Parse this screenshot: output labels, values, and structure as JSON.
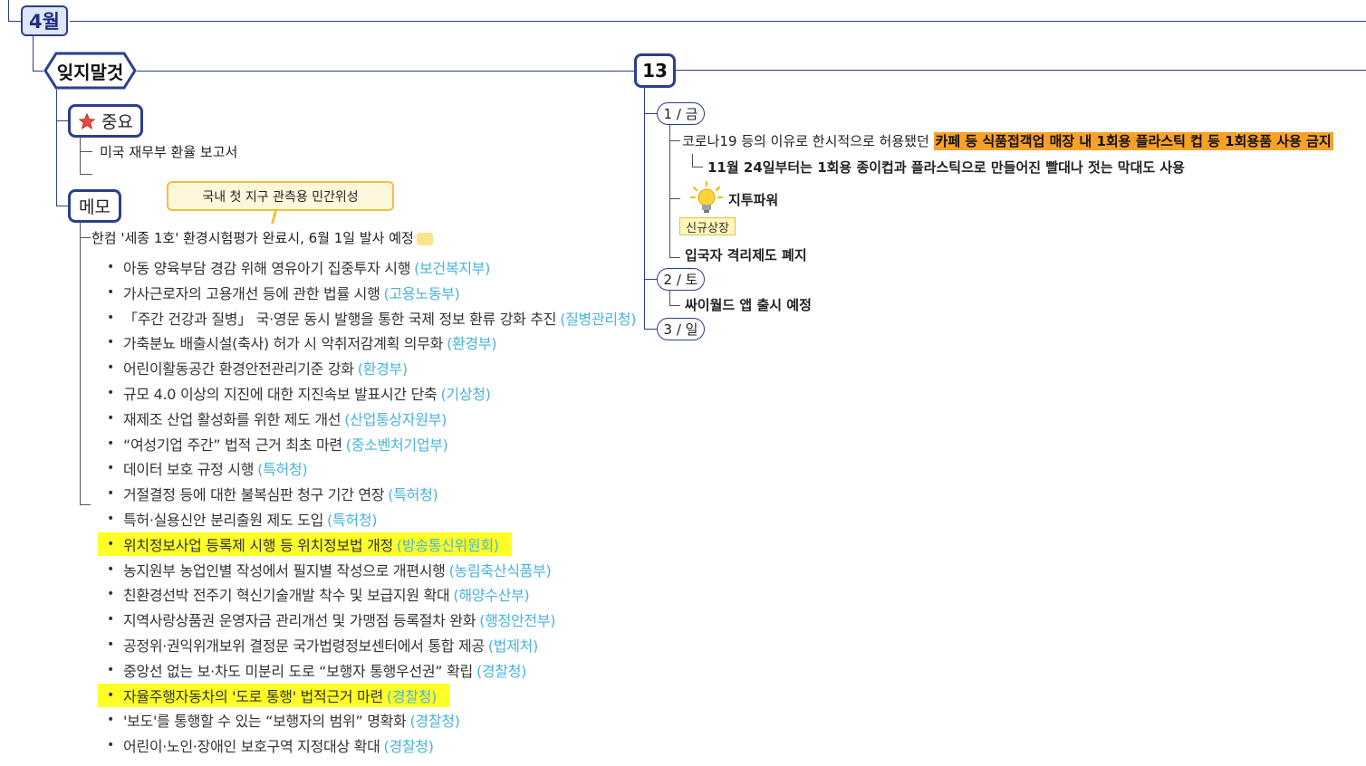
{
  "month": "4월",
  "hex_label": "잊지말것",
  "date_node": "13",
  "important": {
    "label": "중요",
    "items": [
      "미국 재무부 환율 보고서",
      ""
    ]
  },
  "memo": {
    "label": "메모",
    "callout": "국내 첫 지구 관측용 민간위성",
    "line": "한컴 '세종 1호'  환경시험평가  완료시, 6월 1일 발사 예정"
  },
  "policies": [
    {
      "text": "아동 양육부담 경감 위해 영유아기 집중투자 시행",
      "agency": "(보건복지부)",
      "highlight": false
    },
    {
      "text": "가사근로자의 고용개선 등에 관한 법률 시행",
      "agency": "(고용노동부)",
      "highlight": false
    },
    {
      "text": "「주간 건강과 질병」 국·영문 동시 발행을 통한 국제 정보 환류 강화 추진",
      "agency": "(질병관리청)",
      "highlight": false
    },
    {
      "text": "가축분뇨 배출시설(축사) 허가 시 악취저감계획 의무화",
      "agency": "(환경부)",
      "highlight": false
    },
    {
      "text": "어린이활동공간 환경안전관리기준 강화",
      "agency": "(환경부)",
      "highlight": false
    },
    {
      "text": "규모 4.0 이상의 지진에 대한 지진속보 발표시간 단축",
      "agency": "(기상청)",
      "highlight": false
    },
    {
      "text": "재제조 산업 활성화를 위한 제도 개선",
      "agency": "(산업통상자원부)",
      "highlight": false
    },
    {
      "text": "“여성기업 주간” 법적 근거 최초 마련",
      "agency": "(중소벤처기업부)",
      "highlight": false
    },
    {
      "text": "데이터 보호 규정 시행",
      "agency": "(특허청)",
      "highlight": false
    },
    {
      "text": "거절결정 등에 대한 불복심판 청구 기간 연장",
      "agency": "(특허청)",
      "highlight": false
    },
    {
      "text": "특허·실용신안 분리출원 제도 도입",
      "agency": "(특허청)",
      "highlight": false
    },
    {
      "text": "위치정보사업 등록제 시행 등 위치정보법 개정",
      "agency": "(방송통신위원회)",
      "highlight": true
    },
    {
      "text": "농지원부 농업인별 작성에서 필지별 작성으로 개편시행",
      "agency": "(농림축산식품부)",
      "highlight": false
    },
    {
      "text": "친환경선박 전주기 혁신기술개발 착수 및 보급지원 확대",
      "agency": "(해양수산부)",
      "highlight": false
    },
    {
      "text": "지역사랑상품권 운영자금 관리개선 및 가맹점 등록절차 완화",
      "agency": "(행정안전부)",
      "highlight": false
    },
    {
      "text": "공정위·권익위개보위 결정문 국가법령정보센터에서 통합 제공",
      "agency": "(법제처)",
      "highlight": false
    },
    {
      "text": "중앙선 없는 보·차도 미분리 도로 “보행자 통행우선권” 확립",
      "agency": "(경찰청)",
      "highlight": false
    },
    {
      "text": "자율주행자동차의 '도로 통행' 법적근거 마련",
      "agency": "(경찰청)",
      "highlight": true
    },
    {
      "text": "'보도'를 통행할 수 있는 “보행자의 범위” 명확화",
      "agency": "(경찰청)",
      "highlight": false
    },
    {
      "text": "어린이·노인·장애인 보호구역 지정대상 확대",
      "agency": "(경찰청)",
      "highlight": false
    }
  ],
  "schedule": {
    "day1": {
      "label": "1 / 금",
      "text_plain": "코로나19 등의 이유로 한시적으로 허용됐던 ",
      "text_highlight": "카페 등 식품접객업 매장 내 1회용 플라스틱 컵 등 1회용품 사용 금지",
      "sub": "11월 24일부터는 1회용 종이컵과 플라스틱으로 만들어진 빨대나 젓는 막대도 사용",
      "item2": "지투파워",
      "badge": "신규상장",
      "item3": "입국자 격리제도 폐지"
    },
    "day2": {
      "label": "2 / 토",
      "item": "싸이월드 앱 출시 예정"
    },
    "day3": {
      "label": "3 / 일"
    }
  },
  "colors": {
    "accent": "#2b3f8c",
    "agency": "#49b3d9",
    "highlight_yellow": "#ffff27",
    "highlight_orange": "#f7a128"
  }
}
